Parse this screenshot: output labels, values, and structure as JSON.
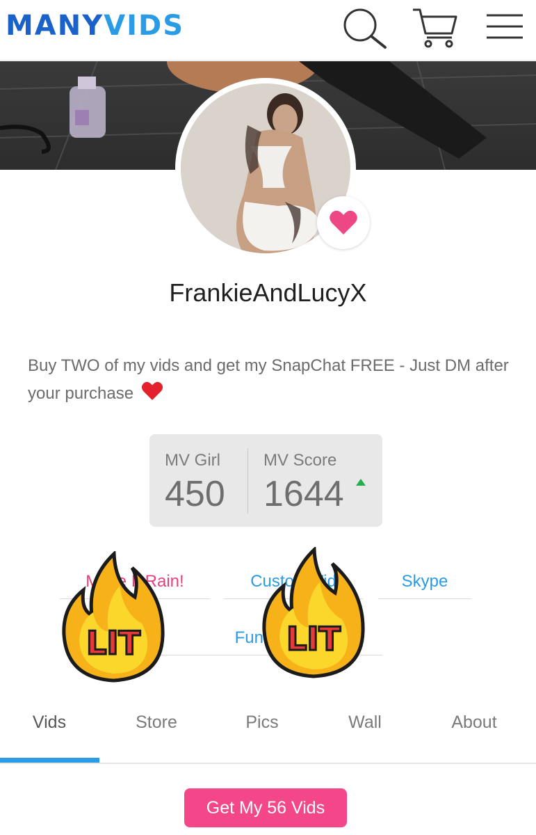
{
  "header": {
    "logo_many": "MANY",
    "logo_vids": "VIDS",
    "icons": [
      "search-icon",
      "cart-icon",
      "menu-icon"
    ]
  },
  "profile": {
    "username": "FrankieAndLucyX",
    "bio": "Buy TWO of my vids and get my SnapChat FREE - Just DM after your purchase",
    "bio_emoji": "heart-icon"
  },
  "scores": {
    "girl_label": "MV Girl",
    "girl_value": "450",
    "score_label": "MV Score",
    "score_value": "1644",
    "score_trend": "up"
  },
  "actions": {
    "make_it_rain": "Make It Rain!",
    "custom": "Custom Vid",
    "skype": "Skype",
    "fund_me": "Fund Me"
  },
  "stickers": {
    "lit_text": "LIT"
  },
  "tabs": [
    {
      "label": "Vids",
      "active": true
    },
    {
      "label": "Store",
      "active": false
    },
    {
      "label": "Pics",
      "active": false
    },
    {
      "label": "Wall",
      "active": false
    },
    {
      "label": "About",
      "active": false
    }
  ],
  "cta": {
    "label": "Get My 56 Vids"
  },
  "colors": {
    "brand_dark": "#1a62c9",
    "brand_light": "#2a9be5",
    "pink": "#f4478a",
    "trend_up": "#23b04b"
  }
}
